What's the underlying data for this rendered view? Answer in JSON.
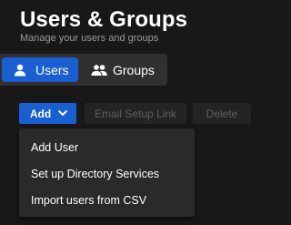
{
  "header": {
    "title": "Users & Groups",
    "subtitle": "Manage your users and groups"
  },
  "tabs": [
    {
      "label": "Users",
      "icon": "user-icon",
      "selected": true
    },
    {
      "label": "Groups",
      "icon": "group-icon",
      "selected": false
    }
  ],
  "toolbar": {
    "add_label": "Add",
    "email_setup_label": "Email Setup Link",
    "delete_label": "Delete"
  },
  "add_menu": {
    "items": [
      {
        "label": "Add User"
      },
      {
        "label": "Set up Directory Services"
      },
      {
        "label": "Import users from CSV"
      }
    ]
  },
  "colors": {
    "background": "#181818",
    "accent": "#1a5fd1",
    "segment_bg": "#303030",
    "disabled_text": "#5e5e5e",
    "menu_bg": "#2a2a2a"
  }
}
